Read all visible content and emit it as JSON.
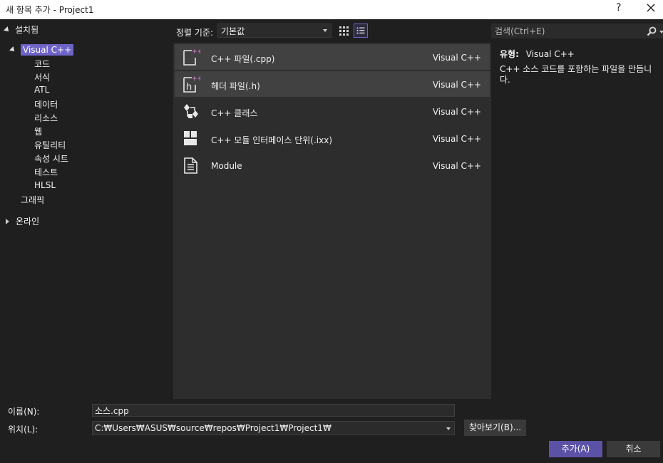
{
  "window": {
    "title": "새 항목 추가 - Project1",
    "help_label": "?"
  },
  "tree": {
    "root_label": "설치됨",
    "selected_label": "Visual C++",
    "children": [
      "코드",
      "서식",
      "ATL",
      "데이터",
      "리소스",
      "웹",
      "유틸리티",
      "속성 시트",
      "테스트",
      "HLSL"
    ],
    "graphic_label": "그래픽",
    "online_label": "온라인"
  },
  "toolbar": {
    "sort_label": "정렬 기준:",
    "sort_value": "기본값"
  },
  "templates": [
    {
      "name": "C++ 파일(.cpp)",
      "lang": "Visual C++",
      "icon": "cpp-file-icon"
    },
    {
      "name": "헤더 파일(.h)",
      "lang": "Visual C++",
      "icon": "header-file-icon"
    },
    {
      "name": "C++ 클래스",
      "lang": "Visual C++",
      "icon": "class-icon"
    },
    {
      "name": "C++ 모듈 인터페이스 단위(.ixx)",
      "lang": "Visual C++",
      "icon": "module-interface-icon"
    },
    {
      "name": "Module",
      "lang": "Visual C++",
      "icon": "module-file-icon"
    }
  ],
  "details": {
    "search_placeholder": "검색(Ctrl+E)",
    "type_label": "유형:",
    "type_value": "Visual C++",
    "description": "C++ 소스 코드를 포함하는 파일을 만듭니다."
  },
  "form": {
    "name_label": "이름(N):",
    "name_value": "소스.cpp",
    "location_label": "위치(L):",
    "location_value": "C:₩Users₩ASUS₩source₩repos₩Project1₩Project1₩",
    "browse_label": "찾아보기(B)...",
    "add_label": "추가(A)",
    "cancel_label": "취소"
  },
  "colors": {
    "accent": "#6e64c8",
    "primary_button": "#5b52a8",
    "background": "#1f1f1f",
    "list_background": "#2d2d2d",
    "icon_plus": "#c77ac7"
  }
}
